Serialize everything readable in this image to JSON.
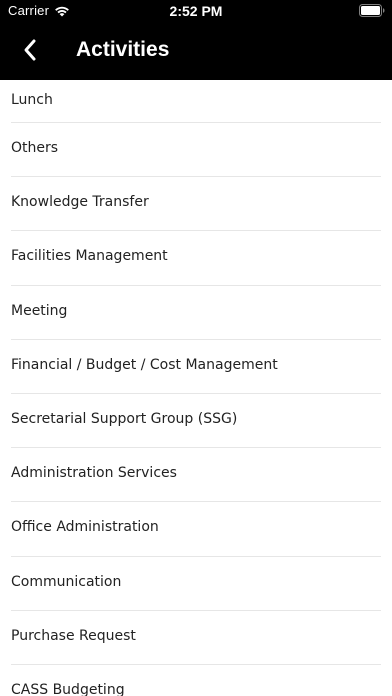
{
  "status_bar": {
    "carrier": "Carrier",
    "time": "2:52 PM",
    "icons": [
      "wifi-icon",
      "battery-icon"
    ]
  },
  "nav": {
    "title": "Activities",
    "back_icon": "chevron-left-icon"
  },
  "activities": [
    "Lunch",
    "Others",
    "Knowledge Transfer",
    "Facilities Management",
    "Meeting",
    "Financial / Budget / Cost Management",
    "Secretarial Support Group (SSG)",
    "Administration Services",
    "Office Administration",
    "Communication",
    "Purchase Request",
    "CASS Budgeting"
  ],
  "colors": {
    "header_bg": "#000000",
    "header_text": "#ffffff",
    "list_text": "#222222",
    "separator": "#e6e6e6"
  }
}
